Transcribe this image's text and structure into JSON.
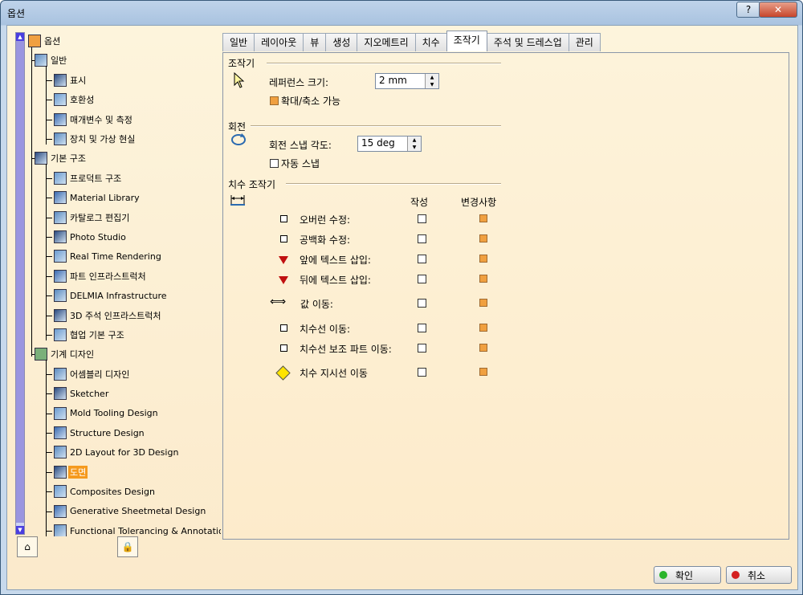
{
  "window": {
    "title": "옵션",
    "help_label": "?",
    "close_label": "✕"
  },
  "tree": {
    "nodes": [
      {
        "label": "옵션",
        "level": 0,
        "icon": "options-root-icon"
      },
      {
        "label": "일반",
        "level": 1,
        "icon": "general-icon"
      },
      {
        "label": "표시",
        "level": 2,
        "icon": "display-icon"
      },
      {
        "label": "호환성",
        "level": 2,
        "icon": "compatibility-icon"
      },
      {
        "label": "매개변수 및 측정",
        "level": 2,
        "icon": "parameters-icon"
      },
      {
        "label": "장치 및 가상 현실",
        "level": 2,
        "icon": "devices-icon"
      },
      {
        "label": "기본 구조",
        "level": 1,
        "icon": "infrastructure-icon"
      },
      {
        "label": "프로덕트 구조",
        "level": 2,
        "icon": "product-structure-icon"
      },
      {
        "label": "Material Library",
        "level": 2,
        "icon": "material-library-icon"
      },
      {
        "label": "카탈로그 편집기",
        "level": 2,
        "icon": "catalog-editor-icon"
      },
      {
        "label": "Photo Studio",
        "level": 2,
        "icon": "photo-studio-icon"
      },
      {
        "label": "Real Time Rendering",
        "level": 2,
        "icon": "rendering-icon"
      },
      {
        "label": "파트 인프라스트럭처",
        "level": 2,
        "icon": "part-infra-icon"
      },
      {
        "label": "DELMIA Infrastructure",
        "level": 2,
        "icon": "delmia-icon"
      },
      {
        "label": "3D 주석 인프라스트럭처",
        "level": 2,
        "icon": "annotation-infra-icon"
      },
      {
        "label": "협업 기본 구조",
        "level": 2,
        "icon": "collab-icon"
      },
      {
        "label": "기계 디자인",
        "level": 1,
        "icon": "mechanical-design-icon"
      },
      {
        "label": "어셈블리 디자인",
        "level": 2,
        "icon": "assembly-icon"
      },
      {
        "label": "Sketcher",
        "level": 2,
        "icon": "sketcher-icon"
      },
      {
        "label": "Mold Tooling Design",
        "level": 2,
        "icon": "mold-icon"
      },
      {
        "label": "Structure Design",
        "level": 2,
        "icon": "structure-icon"
      },
      {
        "label": "2D Layout for 3D Design",
        "level": 2,
        "icon": "layout-icon"
      },
      {
        "label": "도면",
        "level": 2,
        "icon": "drawing-icon",
        "selected": true
      },
      {
        "label": "Composites Design",
        "level": 2,
        "icon": "composites-icon"
      },
      {
        "label": "Generative Sheetmetal Design",
        "level": 2,
        "icon": "sheetmetal-icon"
      },
      {
        "label": "Functional Tolerancing & Annotation",
        "level": 2,
        "icon": "tolerancing-icon"
      }
    ]
  },
  "tabs": [
    "일반",
    "레이아웃",
    "뷰",
    "생성",
    "지오메트리",
    "치수",
    "조작기",
    "주석 및 드레스업",
    "관리"
  ],
  "active_tab": "조작기",
  "manipulator": {
    "title": "조작기",
    "ref_size_label": "레퍼런스 크기:",
    "ref_size_value": "2 mm",
    "zoom_label": "확대/축소 가능",
    "zoom_checked": true
  },
  "rotation": {
    "title": "회전",
    "snap_angle_label": "회전 스냅 각도:",
    "snap_angle_value": "15 deg",
    "auto_snap_label": "자동 스냅",
    "auto_snap_checked": false
  },
  "dim": {
    "title": "치수 조작기",
    "col_create": "작성",
    "col_modify": "변경사항",
    "rows": [
      {
        "label": "오버런 수정:",
        "icon": "square-icon",
        "create": false,
        "modify": true
      },
      {
        "label": "공백화 수정:",
        "icon": "square-icon",
        "create": false,
        "modify": true
      },
      {
        "label": "앞에 텍스트 삽입:",
        "icon": "red-triangle-icon",
        "create": false,
        "modify": true
      },
      {
        "label": "뒤에 텍스트 삽입:",
        "icon": "red-triangle-icon",
        "create": false,
        "modify": true
      },
      {
        "label": "값 이동:",
        "icon": "double-arrow-icon",
        "create": false,
        "modify": true
      },
      {
        "label": "치수선 이동:",
        "icon": "square-icon",
        "create": false,
        "modify": true
      },
      {
        "label": "치수선 보조 파트 이동:",
        "icon": "square-icon",
        "create": false,
        "modify": true
      },
      {
        "label": "치수 지시선 이동",
        "icon": "yellow-diamond-icon",
        "create": false,
        "modify": true
      }
    ]
  },
  "buttons": {
    "ok": "확인",
    "cancel": "취소"
  },
  "colors": {
    "ok_dot": "#2bb52b",
    "cancel_dot": "#d42020",
    "selection": "#f59a1e"
  }
}
